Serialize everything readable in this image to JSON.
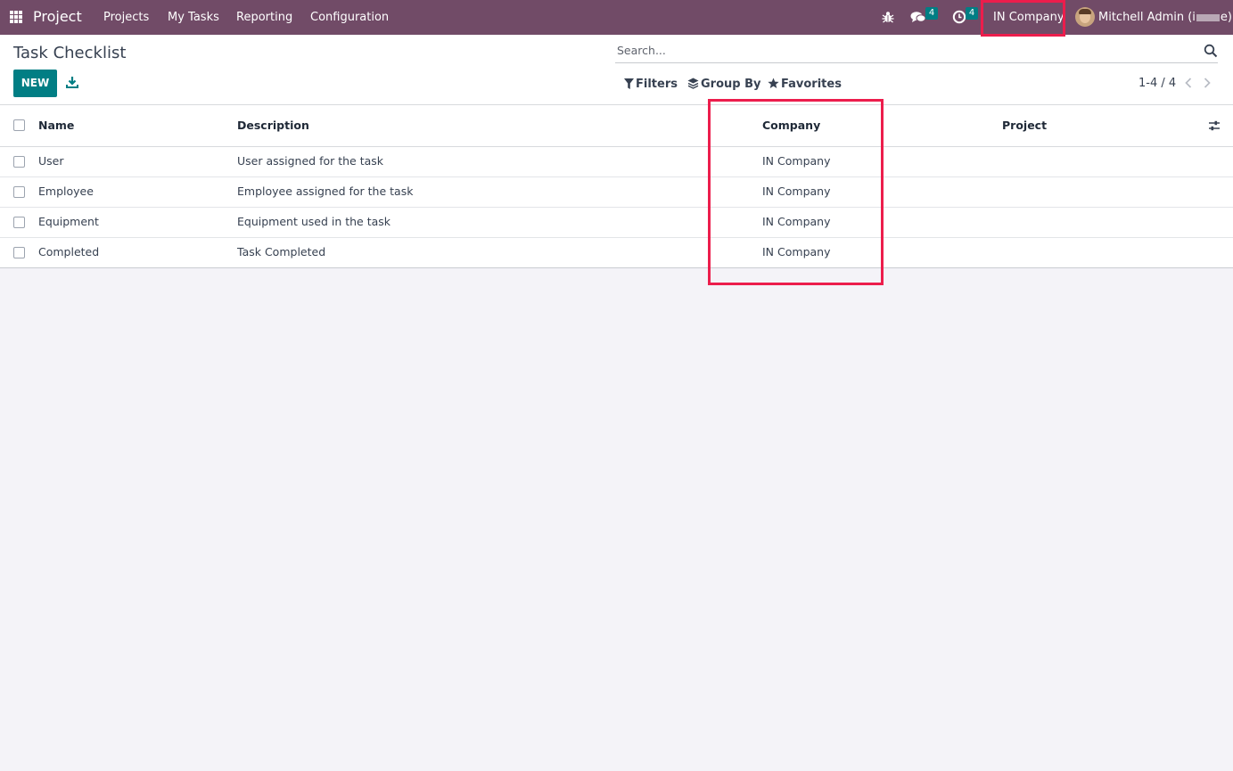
{
  "navbar": {
    "app_name": "Project",
    "menu": [
      "Projects",
      "My Tasks",
      "Reporting",
      "Configuration"
    ],
    "messages_count": "4",
    "activities_count": "4",
    "company": "IN Company",
    "user_name_start": "Mitchell Admin (i",
    "user_name_end": "e)",
    "icons": [
      "apps-grid-icon",
      "bug-icon",
      "chat-icon",
      "clock-icon",
      "avatar"
    ]
  },
  "control_panel": {
    "title": "Task Checklist",
    "new_label": "NEW",
    "search_placeholder": "Search...",
    "filters_label": "Filters",
    "group_by_label": "Group By",
    "favorites_label": "Favorites",
    "pager": "1-4 / 4"
  },
  "table": {
    "headers": {
      "name": "Name",
      "description": "Description",
      "company": "Company",
      "project": "Project"
    },
    "rows": [
      {
        "name": "User",
        "description": "User assigned for the task",
        "company": "IN Company",
        "project": ""
      },
      {
        "name": "Employee",
        "description": "Employee assigned for the task",
        "company": "IN Company",
        "project": ""
      },
      {
        "name": "Equipment",
        "description": "Equipment used in the task",
        "company": "IN Company",
        "project": ""
      },
      {
        "name": "Completed",
        "description": "Task Completed",
        "company": "IN Company",
        "project": ""
      }
    ]
  },
  "colors": {
    "navbar": "#714b67",
    "primary": "#017e84",
    "highlight": "#ec1d4c",
    "background": "#f4f3f8"
  }
}
